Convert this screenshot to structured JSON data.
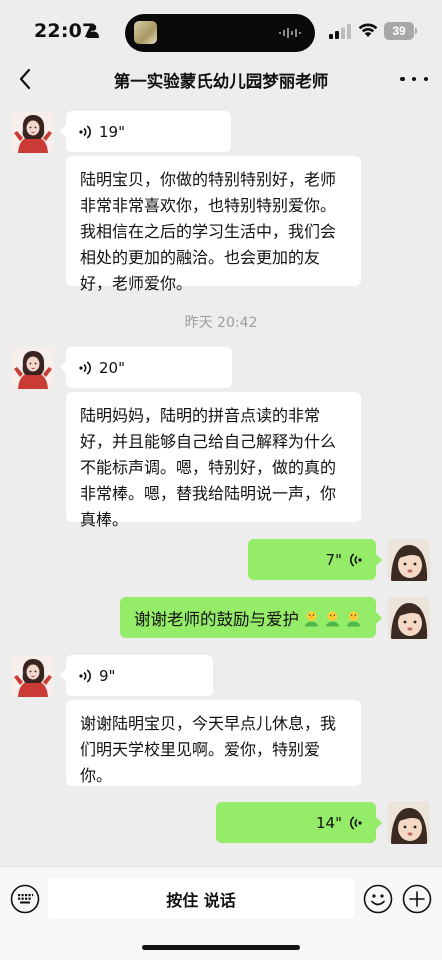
{
  "status_bar": {
    "time": "22:07",
    "battery": "39"
  },
  "nav": {
    "title": "第一实验蒙氏幼儿园梦丽老师"
  },
  "messages": {
    "m1_duration": "19\"",
    "m1_transcript": "陆明宝贝，你做的特别特别好，老师非常非常喜欢你，也特别特别爱你。我相信在之后的学习生活中，我们会相处的更加的融洽。也会更加的友好，老师爱你。",
    "timestamp": "昨天 20:42",
    "m2_duration": "20\"",
    "m2_transcript": "陆明妈妈，陆明的拼音点读的非常好，并且能够自己给自己解释为什么不能标声调。嗯，特别好，做的真的非常棒。嗯，替我给陆明说一声，你真棒。",
    "m3_duration": "7\"",
    "m4_text": "谢谢老师的鼓励与爱护",
    "m5_duration": "9\"",
    "m5_transcript": "谢谢陆明宝贝，今天早点儿休息，我们明天学校里见啊。爱你，特别爱你。",
    "m6_duration": "14\""
  },
  "input_bar": {
    "hold_to_talk": "按住 说话"
  },
  "colors": {
    "background": "#ededed",
    "my_bubble": "#95ec69",
    "their_bubble": "#ffffff"
  },
  "icons": [
    "person-icon",
    "signal-icon",
    "wifi-icon",
    "back-icon",
    "more-icon",
    "voice-icon",
    "keyboard-icon",
    "smiley-icon",
    "plus-icon"
  ]
}
